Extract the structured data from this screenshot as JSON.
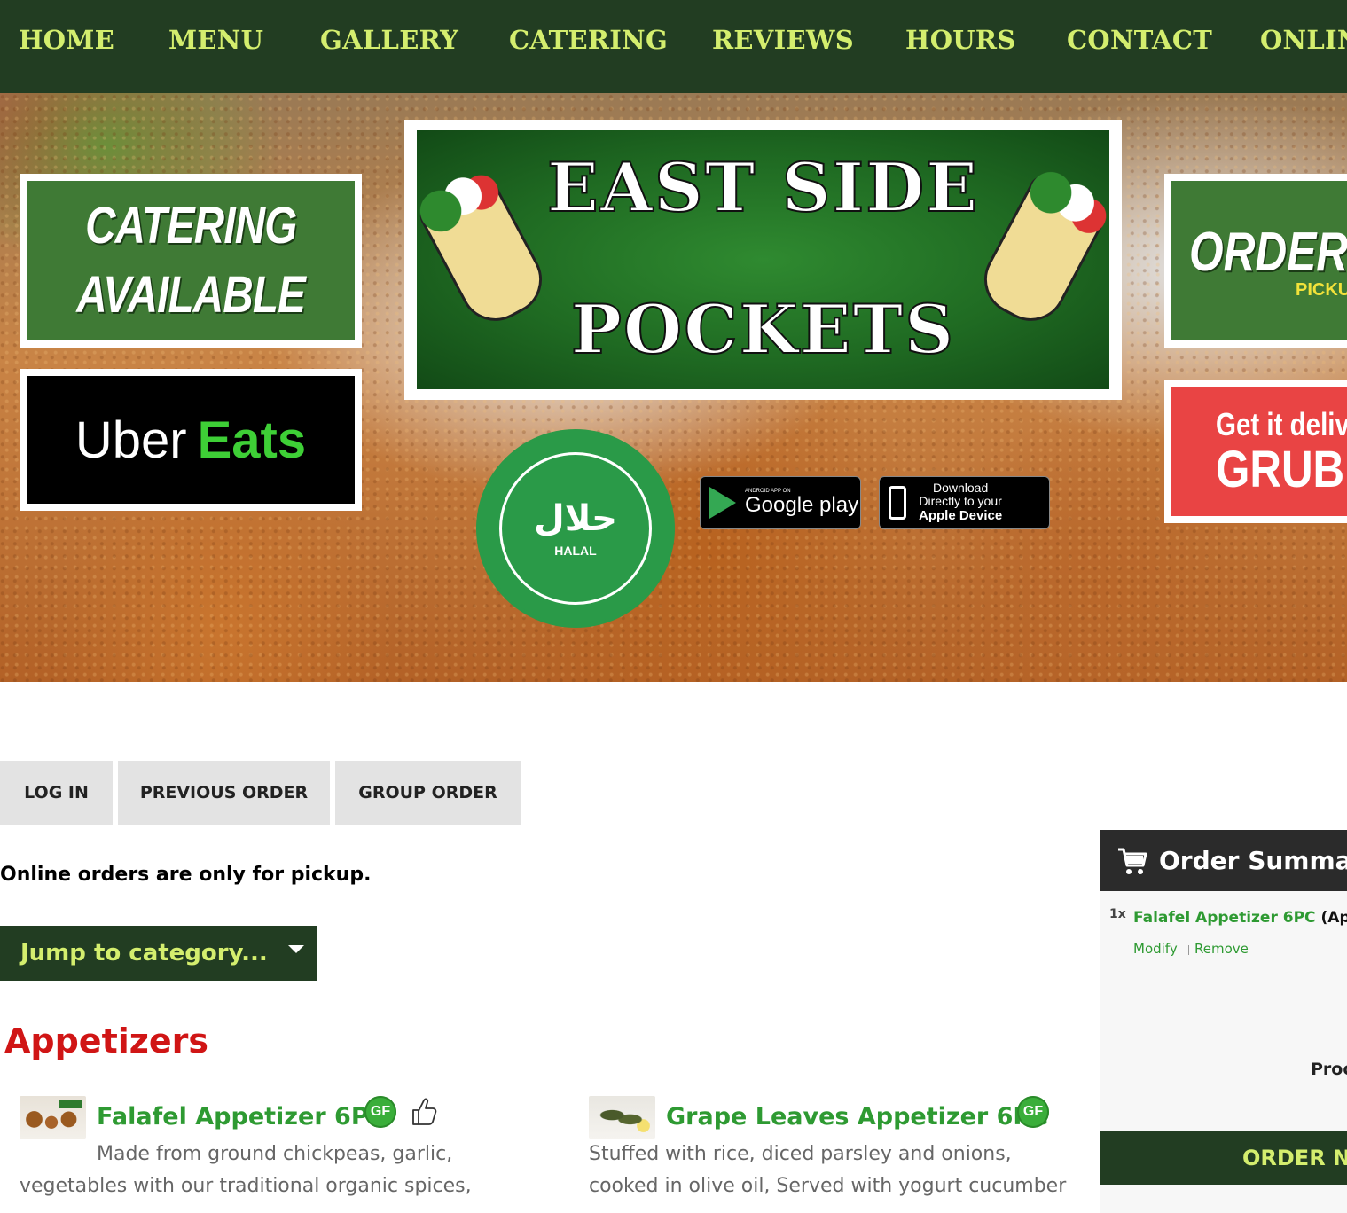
{
  "nav": {
    "items": [
      "HOME",
      "MENU",
      "GALLERY",
      "CATERING",
      "REVIEWS",
      "HOURS",
      "CONTACT",
      "ONLIN"
    ]
  },
  "hero": {
    "catering_promo": [
      "CATERING",
      "AVAILABLE"
    ],
    "uber_promo": {
      "word1": "Uber",
      "word2": "Eats"
    },
    "logo": {
      "line1": "EAST SIDE",
      "line2": "POCKETS"
    },
    "halal_seal": {
      "arabic": "حلال",
      "text": "HALAL"
    },
    "google_play": {
      "small": "ANDROID APP ON",
      "big": "Google play"
    },
    "apple": {
      "line1": "Download",
      "line2": "Directly to your",
      "line3": "Apple Device"
    },
    "order_promo": {
      "line1": "ORDER O",
      "line2": "PICKUP"
    },
    "grub_promo": {
      "line1": "Get it delive",
      "line2": "GRUB"
    }
  },
  "actions": {
    "login": "LOG IN",
    "previous_order": "PREVIOUS ORDER",
    "group_order": "GROUP ORDER"
  },
  "notice": "Online orders are only for pickup.",
  "jump_to_category": "Jump to category...",
  "category": {
    "title": "Appetizers",
    "items": [
      {
        "name": "Falafel Appetizer 6PC",
        "badge": "GF",
        "desc_lines": [
          "Made from ground chickpeas, garlic,",
          "vegetables with our traditional organic spices,"
        ]
      },
      {
        "name": "Grape Leaves Appetizer 6PC",
        "badge": "GF",
        "desc_lines": [
          "Stuffed with rice, diced parsley and onions,",
          "cooked in olive oil, Served with yogurt cucumber"
        ]
      }
    ]
  },
  "summary": {
    "title": "Order Summar",
    "qty": "1x",
    "item_name": "Falafel Appetizer 6PC",
    "item_category": "(Appe",
    "modify": "Modify",
    "remove": "Remove",
    "processing": "Proc",
    "order_now": "ORDER NO"
  },
  "colors": {
    "nav_bg": "#223d22",
    "nav_text": "#d4ee6e",
    "accent_green": "#2e9a32",
    "category_red": "#d01515"
  }
}
